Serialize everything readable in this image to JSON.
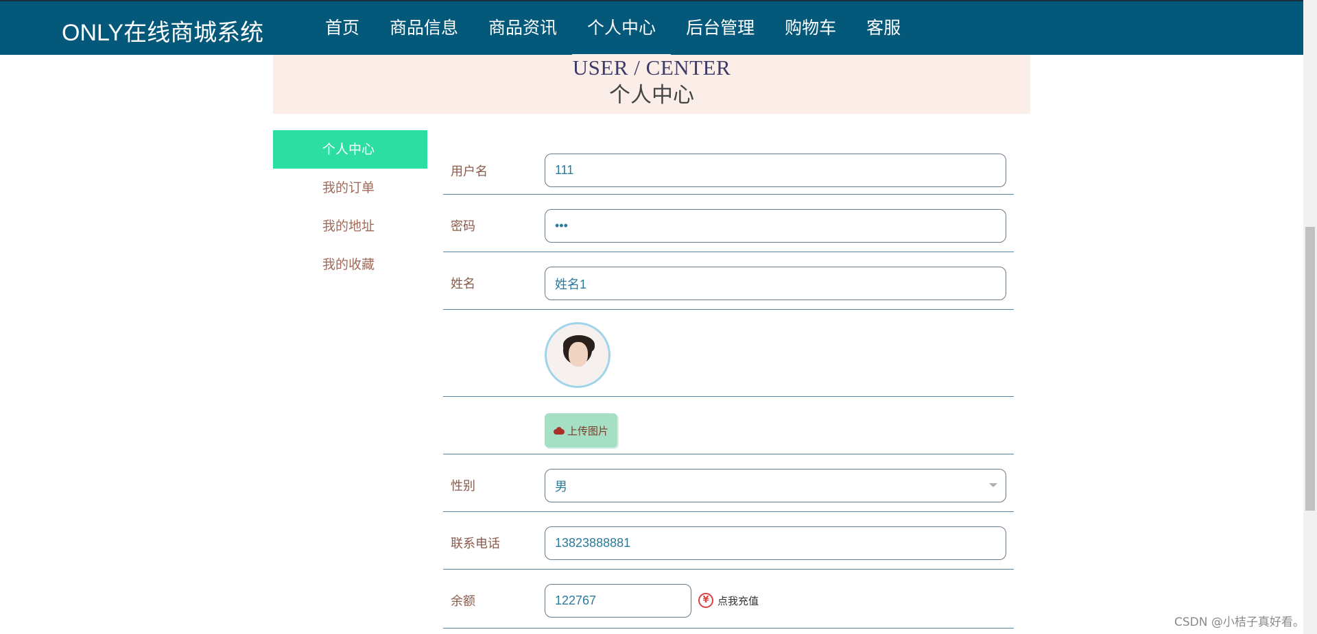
{
  "header": {
    "brand": "ONLY在线商城系统",
    "nav": [
      "首页",
      "商品信息",
      "商品资讯",
      "个人中心",
      "后台管理",
      "购物车",
      "客服"
    ],
    "active_nav": "个人中心"
  },
  "banner": {
    "title_en": "USER / CENTER",
    "title_zh": "个人中心"
  },
  "sidebar": {
    "items": [
      {
        "label": "个人中心",
        "active": true
      },
      {
        "label": "我的订单",
        "active": false
      },
      {
        "label": "我的地址",
        "active": false
      },
      {
        "label": "我的收藏",
        "active": false
      }
    ]
  },
  "form": {
    "username": {
      "label": "用户名",
      "value": "111"
    },
    "password": {
      "label": "密码",
      "value": "•••"
    },
    "name": {
      "label": "姓名",
      "value": "姓名1"
    },
    "upload_label": "上传图片",
    "gender": {
      "label": "性别",
      "value": "男"
    },
    "phone": {
      "label": "联系电话",
      "value": "13823888881"
    },
    "balance": {
      "label": "余额",
      "value": "122767",
      "recharge_icon": "¥",
      "recharge_label": "点我充值"
    }
  },
  "watermark": "CSDN @小桔子真好看。",
  "colors": {
    "topbar": "#04587a",
    "sidebar_active": "#2ddea3",
    "banner_bg": "#fbeee8",
    "upload_btn": "#a5e0c5"
  }
}
